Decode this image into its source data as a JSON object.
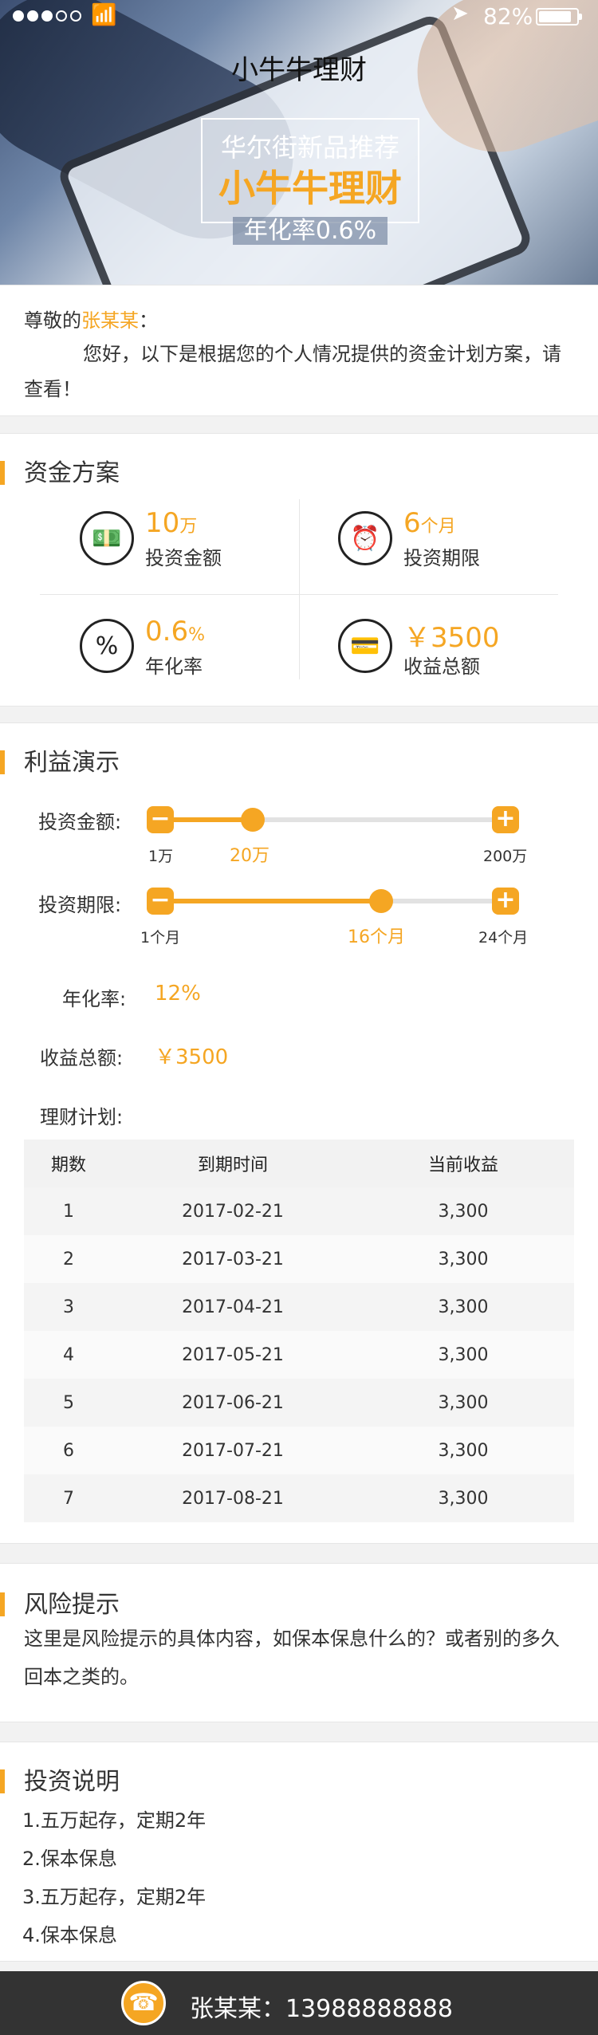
{
  "status": {
    "battery": "82%"
  },
  "header": {
    "title": "小牛牛理财",
    "promo_line1": "华尔街新品推荐",
    "promo_line2": "小牛牛理财",
    "promo_line3": "年化率0.6%"
  },
  "greeting": {
    "prefix": "尊敬的",
    "name": "张某某",
    "suffix": "：",
    "message": "您好，以下是根据您的个人情况提供的资金计划方案，请查看！"
  },
  "plan": {
    "title": "资金方案",
    "items": [
      {
        "value": "10",
        "unit": "万",
        "label": "投资金额",
        "icon": "money-stack-icon"
      },
      {
        "value": "6",
        "unit": "个月",
        "label": "投资期限",
        "icon": "alarm-clock-icon"
      },
      {
        "value": "0.6",
        "unit": "%",
        "label": "年化率",
        "icon": "percent-icon"
      },
      {
        "value": "￥3500",
        "unit": "",
        "label": "收益总额",
        "icon": "wallet-card-icon"
      }
    ]
  },
  "demo": {
    "title": "利益演示",
    "amount": {
      "label": "投资金额:",
      "min": "1万",
      "current": "20万",
      "max": "200万",
      "fraction": 0.27
    },
    "term": {
      "label": "投资期限:",
      "min": "1个月",
      "current": "16个月",
      "max": "24个月",
      "fraction": 0.64
    },
    "rate": {
      "label": "年化率:",
      "value": "12%"
    },
    "income": {
      "label": "收益总额:",
      "value": "￥3500"
    },
    "plan_label": "理财计划:",
    "table": {
      "headers": [
        "期数",
        "到期时间",
        "当前收益"
      ],
      "rows": [
        [
          "1",
          "2017-02-21",
          "3,300"
        ],
        [
          "2",
          "2017-03-21",
          "3,300"
        ],
        [
          "3",
          "2017-04-21",
          "3,300"
        ],
        [
          "4",
          "2017-05-21",
          "3,300"
        ],
        [
          "5",
          "2017-06-21",
          "3,300"
        ],
        [
          "6",
          "2017-07-21",
          "3,300"
        ],
        [
          "7",
          "2017-08-21",
          "3,300"
        ]
      ]
    }
  },
  "risk": {
    "title": "风险提示",
    "text": "这里是风险提示的具体内容，如保本保息什么的？或者别的多久回本之类的。"
  },
  "invest": {
    "title": "投资说明",
    "items": [
      "1.五万起存，定期2年",
      "2.保本保息",
      "3.五万起存，定期2年",
      "4.保本保息"
    ]
  },
  "footer": {
    "contact": "张某某：13988888888"
  },
  "colors": {
    "accent": "#f5a623",
    "footer_bg": "#333333"
  }
}
